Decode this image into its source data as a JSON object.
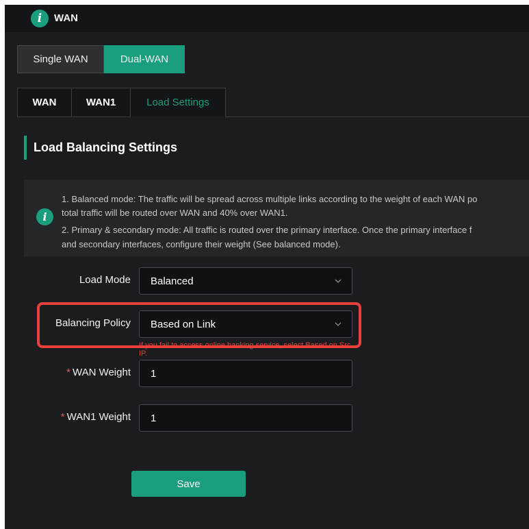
{
  "header": {
    "title": "WAN",
    "icon": "info-icon"
  },
  "wan_mode": {
    "options": [
      "Single WAN",
      "Dual-WAN"
    ],
    "selected": "Dual-WAN"
  },
  "tabs": [
    {
      "label": "WAN",
      "active": false
    },
    {
      "label": "WAN1",
      "active": false
    },
    {
      "label": "Load Settings",
      "active": true
    }
  ],
  "section": {
    "title": "Load Balancing Settings"
  },
  "info": {
    "line1": "1. Balanced mode: The traffic will be spread across multiple links according to the weight of each WAN po",
    "line2": "total traffic will be routed over WAN and 40% over WAN1.",
    "line3": "2. Primary & secondary mode: All traffic is routed over the primary interface. Once the primary interface f",
    "line4": "and secondary interfaces, configure their weight (See balanced mode)."
  },
  "form": {
    "load_mode": {
      "label": "Load Mode",
      "value": "Balanced"
    },
    "balancing_policy": {
      "label": "Balancing Policy",
      "value": "Based on Link",
      "hint": "If you fail to access online banking service, select Based on Src IP."
    },
    "wan_weight": {
      "required_mark": "*",
      "label": "WAN Weight",
      "value": "1"
    },
    "wan1_weight": {
      "required_mark": "*",
      "label": "WAN1 Weight",
      "value": "1"
    }
  },
  "actions": {
    "save_label": "Save"
  },
  "colors": {
    "accent": "#1a9e7e",
    "highlight": "#e8413b",
    "background": "#1b1c1f"
  }
}
